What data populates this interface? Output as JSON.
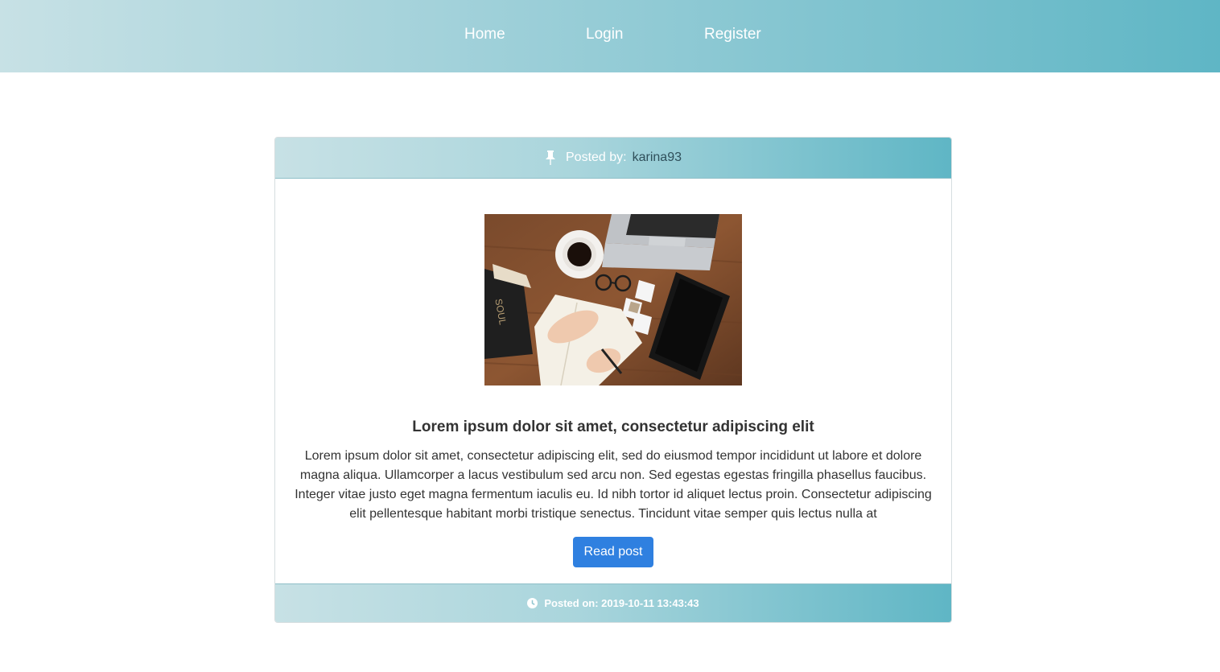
{
  "nav": {
    "home": "Home",
    "login": "Login",
    "register": "Register"
  },
  "post": {
    "posted_by_label": "Posted by:",
    "author": "karina93",
    "title": "Lorem ipsum dolor sit amet, consectetur adipiscing elit",
    "body": "Lorem ipsum dolor sit amet, consectetur adipiscing elit, sed do eiusmod tempor incididunt ut labore et dolore magna aliqua. Ullamcorper a lacus vestibulum sed arcu non. Sed egestas egestas fringilla phasellus faucibus. Integer vitae justo eget magna fermentum iaculis eu. Id nibh tortor id aliquet lectus proin. Consectetur adipiscing elit pellentesque habitant morbi tristique senectus. Tincidunt vitae semper quis lectus nulla at",
    "read_button": "Read post",
    "posted_on": "Posted on: 2019-10-11 13:43:43"
  },
  "icons": {
    "header": "pin-icon",
    "footer": "clock-icon"
  },
  "colors": {
    "nav_gradient_start": "#c7e1e5",
    "nav_gradient_end": "#5fb6c5",
    "button": "#2f80e0"
  }
}
